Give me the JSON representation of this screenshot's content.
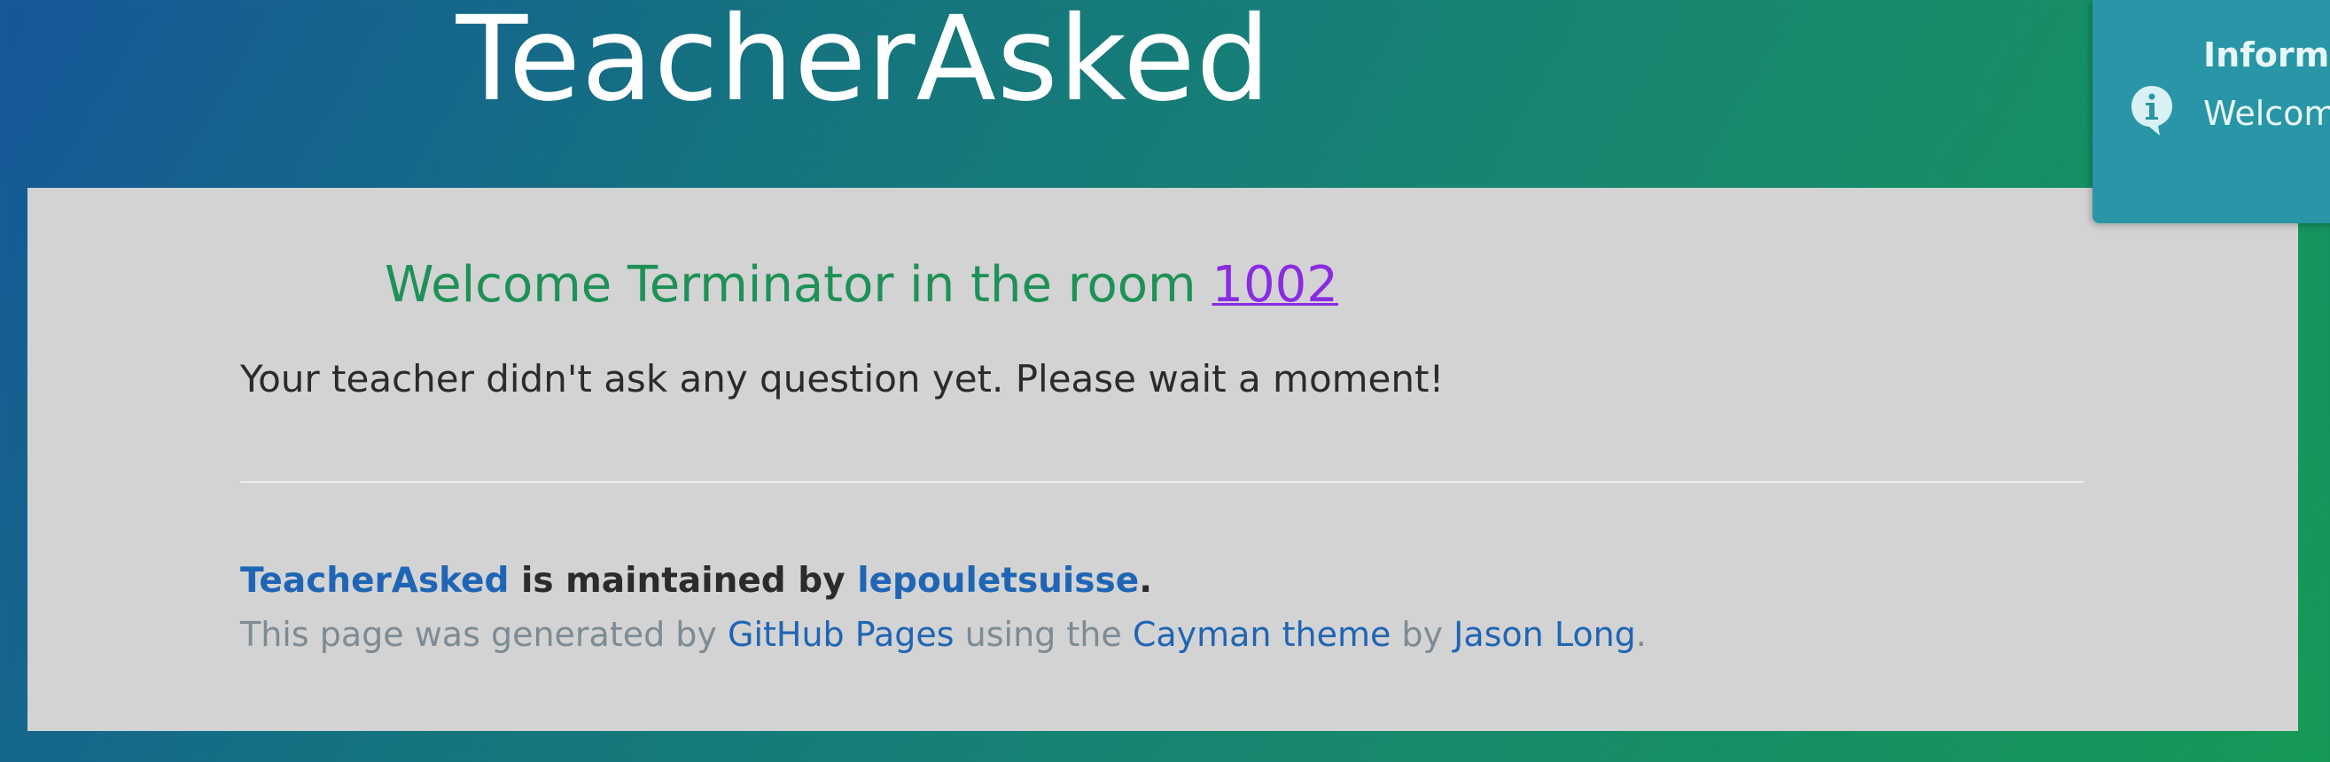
{
  "header": {
    "title": "TeacherAsked"
  },
  "main": {
    "welcome_prefix": "Welcome Terminator in the room ",
    "room_number": "1002",
    "wait_message": "Your teacher didn't ask any question yet. Please wait a moment!"
  },
  "footer": {
    "project_link": "TeacherAsked",
    "maintained_by": " is maintained by ",
    "author_link": "lepouletsuisse",
    "period": ".",
    "generated_prefix": "This page was generated by ",
    "github_pages_link": "GitHub Pages",
    "using_the": " using the ",
    "theme_link": "Cayman theme",
    "by": " by ",
    "theme_author_link": "Jason Long",
    "end_period": "."
  },
  "toast": {
    "title": "Informa",
    "message": "Welcom Termina",
    "icon": "info-bubble-icon"
  },
  "colors": {
    "gradient_start": "#155799",
    "gradient_end": "#159957",
    "panel_background": "#d3d3d3",
    "welcome_green": "#1e9156",
    "room_link_purple": "#8a2be2",
    "link_blue": "#1f65b5",
    "toast_background": "#2896a6"
  }
}
